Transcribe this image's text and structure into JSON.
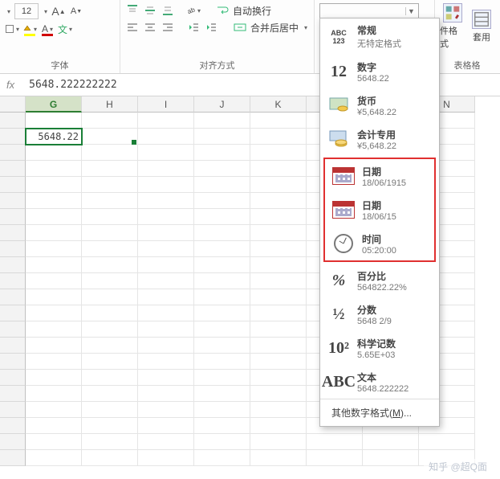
{
  "ribbon": {
    "font_size": "12",
    "group_font": "字体",
    "group_align": "对齐方式",
    "wrap_text": "自动换行",
    "merge_center": "合并后居中",
    "cond_fmt_top": "件格式",
    "cond_fmt_bottom": "表格格",
    "table_fmt": "套用"
  },
  "formula_bar": {
    "fx": "fx",
    "value": "5648.222222222"
  },
  "grid": {
    "cols": [
      "G",
      "H",
      "I",
      "J",
      "K",
      "",
      "",
      "N"
    ],
    "selected_col": "G",
    "cell_value": "5648.22"
  },
  "num_dropdown": {
    "items": [
      {
        "key": "general",
        "title": "常规",
        "sample": "无特定格式",
        "icon_text": "ABC\n123"
      },
      {
        "key": "number",
        "title": "数字",
        "sample": "5648.22",
        "icon_text": "12"
      },
      {
        "key": "currency",
        "title": "货币",
        "sample": "¥5,648.22",
        "icon_kind": "currency"
      },
      {
        "key": "accounting",
        "title": "会计专用",
        "sample": "¥5,648.22",
        "icon_kind": "accounting"
      },
      {
        "key": "date_long",
        "title": "日期",
        "sample": "18/06/1915",
        "icon_kind": "calendar",
        "hi": true
      },
      {
        "key": "date_short",
        "title": "日期",
        "sample": "18/06/15",
        "icon_kind": "calendar",
        "hi": true
      },
      {
        "key": "time",
        "title": "时间",
        "sample": "05:20:00",
        "icon_kind": "clock",
        "hi": true
      },
      {
        "key": "percent",
        "title": "百分比",
        "sample": "564822.22%",
        "icon_text": "%"
      },
      {
        "key": "fraction",
        "title": "分数",
        "sample": "5648 2/9",
        "icon_text": "½"
      },
      {
        "key": "scientific",
        "title": "科学记数",
        "sample": "5.65E+03",
        "icon_text": "10²"
      },
      {
        "key": "text",
        "title": "文本",
        "sample": "5648.222222",
        "icon_text": "ABC"
      }
    ],
    "more": "其他数字格式(M)..."
  },
  "watermark": "知乎 @超Q面"
}
